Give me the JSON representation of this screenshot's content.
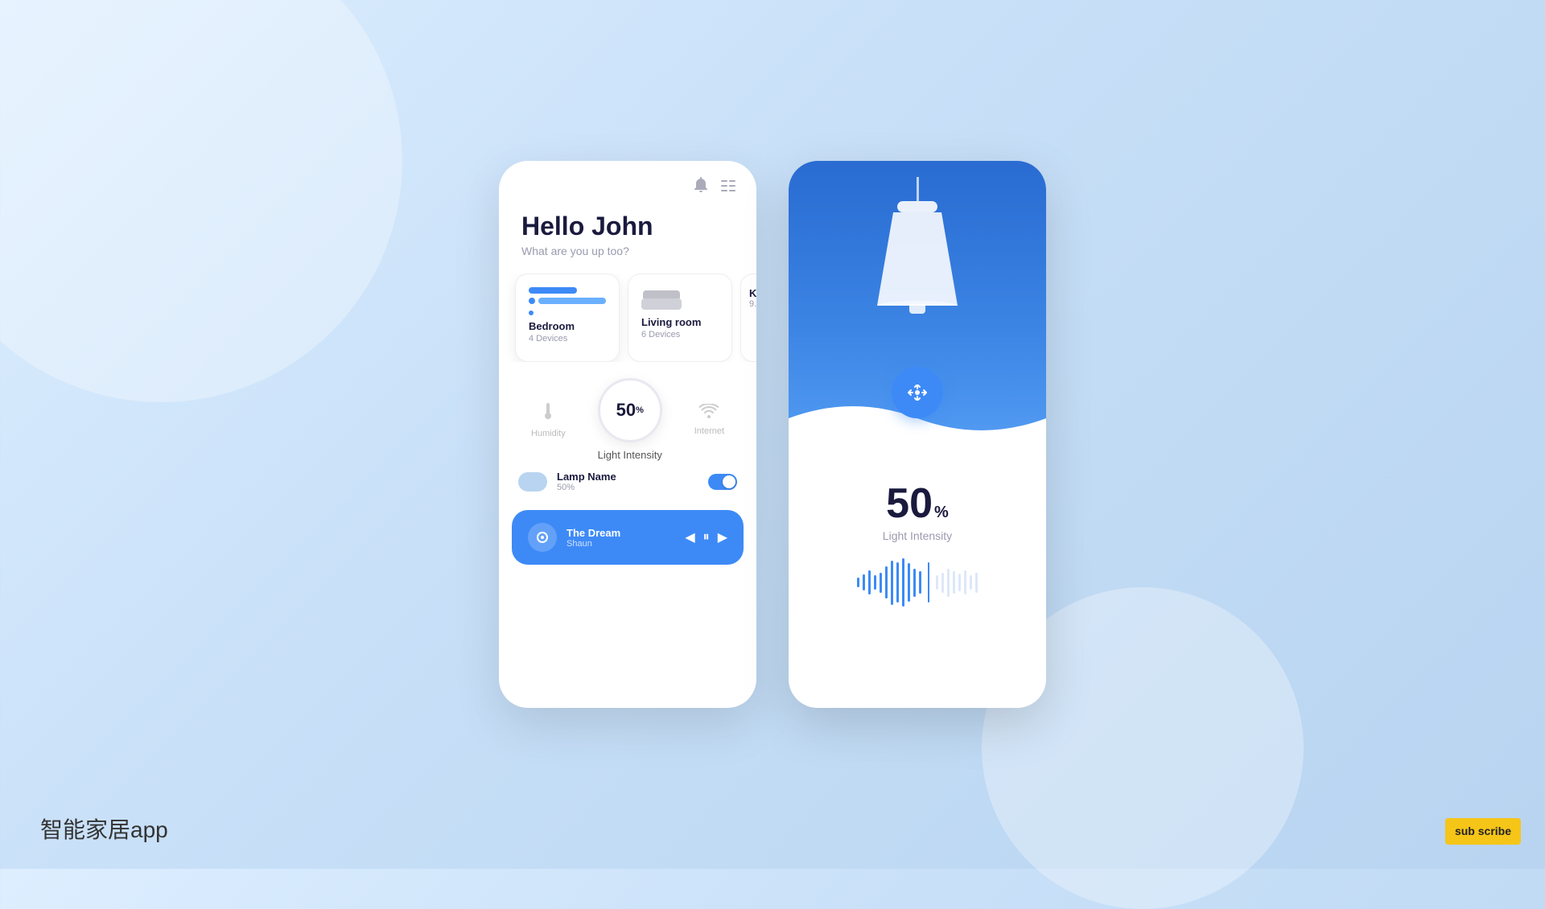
{
  "app": {
    "watermark": "智能家居app",
    "subscribe": "sub\nscribe"
  },
  "left_phone": {
    "header": {
      "bell_icon": "🔔",
      "menu_icon": "⋮⋮"
    },
    "greeting": {
      "title": "Hello John",
      "subtitle": "What are you up too?"
    },
    "rooms": [
      {
        "name": "Bedroom",
        "devices": "4 Devices",
        "active": true,
        "icon_type": "bed"
      },
      {
        "name": "Living room",
        "devices": "6 Devices",
        "active": false,
        "icon_type": "sofa"
      },
      {
        "name": "K...",
        "devices": "9...",
        "active": false,
        "icon_type": "sofa",
        "partial": true
      }
    ],
    "stats": {
      "humidity_label": "Humidity",
      "light_value": "50",
      "light_unit": "%",
      "internet_label": "Internet",
      "light_intensity_label": "Light Intensity"
    },
    "lamp": {
      "name": "Lamp Name",
      "percent": "50%",
      "toggle_on": true
    },
    "music": {
      "title": "The Dream",
      "artist": "Shaun",
      "play_icon": "▶",
      "pause_icon": "⏸",
      "prev_icon": "◀",
      "next_icon": "▶"
    }
  },
  "right_phone": {
    "intensity": {
      "value": "50",
      "unit": "%",
      "label": "Light Intensity"
    },
    "control": {
      "icon": "◀ ▶"
    }
  }
}
